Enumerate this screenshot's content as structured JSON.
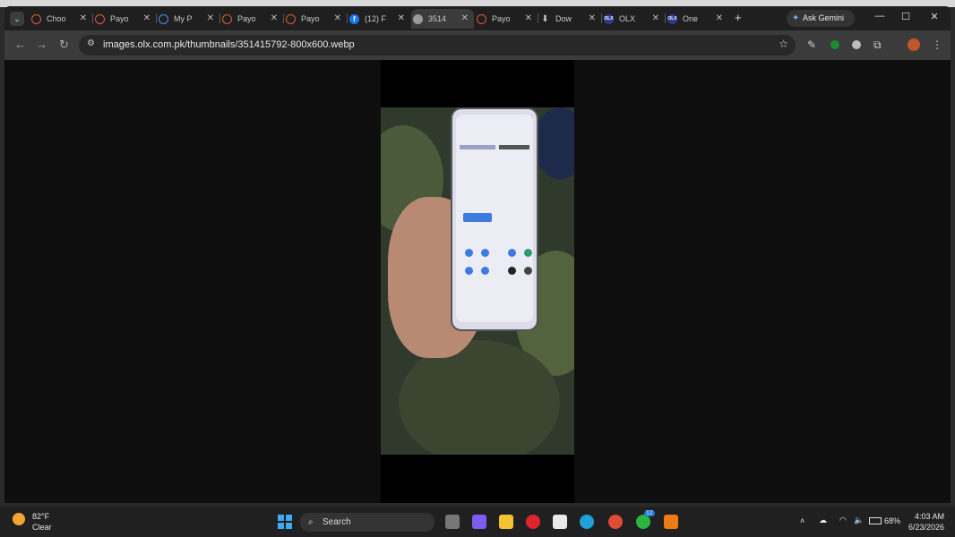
{
  "browser": {
    "tabs": [
      {
        "label": "Choo",
        "fav": "ring-o"
      },
      {
        "label": "Payo",
        "fav": "ring-o"
      },
      {
        "label": "My P",
        "fav": "ring-b"
      },
      {
        "label": "Payo",
        "fav": "ring-o"
      },
      {
        "label": "Payo",
        "fav": "ring-o"
      },
      {
        "label": "(12) F",
        "fav": "facebook"
      },
      {
        "label": "3514",
        "fav": "globe",
        "active": true
      },
      {
        "label": "Payo",
        "fav": "ring-o"
      },
      {
        "label": "Dow",
        "fav": "download"
      },
      {
        "label": "OLX",
        "fav": "olx"
      },
      {
        "label": "One",
        "fav": "olx"
      }
    ],
    "olx_fav_text": "OLX",
    "fb_fav_text": "f",
    "close_glyph": "✕",
    "new_tab_glyph": "+",
    "ask_gemini_label": "Ask Gemini",
    "url": "images.olx.com.pk/thumbnails/351415792-800x600.webp"
  },
  "taskbar": {
    "weather_temp": "82°F",
    "weather_desc": "Clear",
    "search_label": "Search",
    "battery": "68%",
    "time": "4:03 AM",
    "date": "6/23/2026",
    "whatsapp_badge": "12"
  },
  "colors": {
    "accent": "#4a8df0",
    "tab_active": "#3b3b3b"
  }
}
